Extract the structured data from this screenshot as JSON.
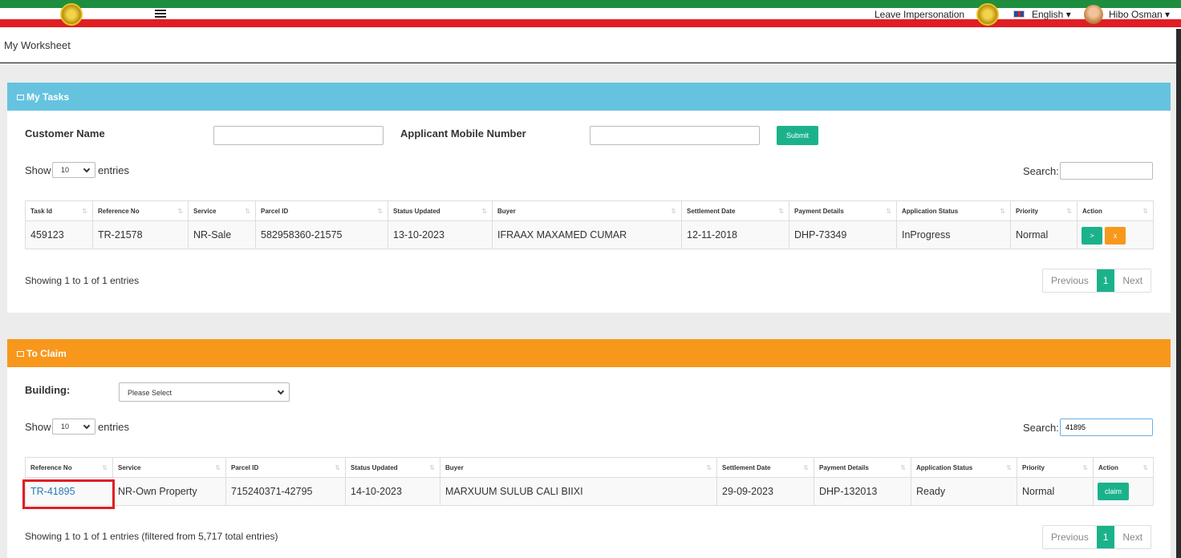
{
  "header": {
    "leave_impersonation": "Leave Impersonation",
    "language": "English ▾",
    "user_name": "Hibo Osman ▾"
  },
  "breadcrumb": "My Worksheet",
  "tasks": {
    "title": "My Tasks",
    "customer_name_label": "Customer Name",
    "mobile_label": "Applicant Mobile Number",
    "submit": "Submit",
    "show": "Show",
    "entries": "entries",
    "page_length": "10",
    "search_label": "Search:",
    "search_value": "",
    "columns": [
      "Task Id",
      "Reference No",
      "Service",
      "Parcel ID",
      "Status Updated",
      "Buyer",
      "Settlement Date",
      "Payment Details",
      "Application Status",
      "Priority",
      "Action"
    ],
    "rows": [
      [
        "459123",
        "TR-21578",
        "NR-Sale",
        "582958360-21575",
        "13-10-2023",
        "IFRAAX MAXAMED CUMAR",
        "12-11-2018",
        "DHP-73349",
        "InProgress",
        "Normal"
      ]
    ],
    "action_go": ">",
    "action_close": "x",
    "info": "Showing 1 to 1 of 1 entries",
    "previous": "Previous",
    "page": "1",
    "next": "Next"
  },
  "claim": {
    "title": "To Claim",
    "building_label": "Building:",
    "building_value": "Please Select",
    "show": "Show",
    "entries": "entries",
    "page_length": "10",
    "search_label": "Search:",
    "search_value": "41895",
    "columns": [
      "Reference No",
      "Service",
      "Parcel ID",
      "Status Updated",
      "Buyer",
      "Settlement Date",
      "Payment Details",
      "Application Status",
      "Priority",
      "Action"
    ],
    "rows": [
      [
        "TR-41895",
        "NR-Own Property",
        "715240371-42795",
        "14-10-2023",
        "MARXUUM SULUB CALI BIIXI",
        "29-09-2023",
        "DHP-132013",
        "Ready",
        "Normal"
      ]
    ],
    "action_claim": "claim",
    "info": "Showing 1 to 1 of 1 entries (filtered from 5,717 total entries)",
    "previous": "Previous",
    "page": "1",
    "next": "Next"
  }
}
